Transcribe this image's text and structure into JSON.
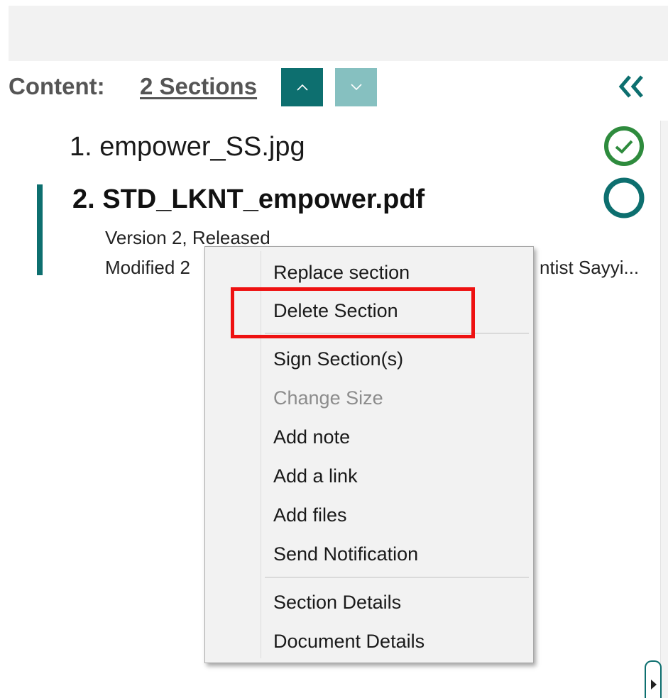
{
  "header": {
    "content_label": "Content:",
    "sections_link": "2 Sections"
  },
  "icons": {
    "nav_up": "chevron-up-icon",
    "nav_down": "chevron-down-icon",
    "collapse": "double-chevron-left-icon",
    "item1_status": "check-circle-icon",
    "item2_status": "empty-circle-icon",
    "scroll": "caret-right-icon"
  },
  "colors": {
    "accent": "#0d6f6f",
    "accent_light": "#86c0c0",
    "status_complete": "#2e8b3d",
    "highlight": "#ee1111"
  },
  "sections": [
    {
      "label": "1. empower_SS.jpg",
      "status": "complete"
    },
    {
      "label": "2. STD_LKNT_empower.pdf",
      "status": "pending",
      "meta_line1": "Version 2, Released",
      "meta_line2_start": "Modified 2",
      "meta_line2_end": "ntist Sayyi..."
    }
  ],
  "context_menu": {
    "group1": [
      {
        "label": "Replace section",
        "enabled": true
      },
      {
        "label": "Delete Section",
        "enabled": true,
        "highlighted": true
      }
    ],
    "group2": [
      {
        "label": "Sign Section(s)",
        "enabled": true
      },
      {
        "label": "Change Size",
        "enabled": false
      },
      {
        "label": "Add note",
        "enabled": true
      },
      {
        "label": "Add a link",
        "enabled": true
      },
      {
        "label": "Add files",
        "enabled": true
      },
      {
        "label": "Send Notification",
        "enabled": true
      }
    ],
    "group3": [
      {
        "label": "Section Details",
        "enabled": true
      },
      {
        "label": "Document Details",
        "enabled": true
      }
    ]
  }
}
